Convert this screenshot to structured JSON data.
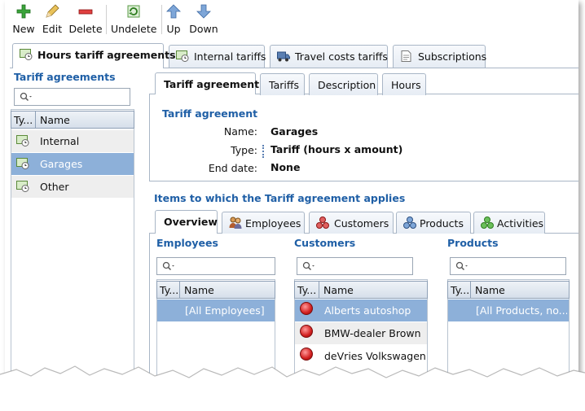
{
  "toolbar": {
    "buttons": [
      {
        "label": "New"
      },
      {
        "label": "Edit"
      },
      {
        "label": "Delete"
      },
      {
        "label": "Undelete"
      },
      {
        "label": "Up"
      },
      {
        "label": "Down"
      }
    ]
  },
  "main_tabs": [
    {
      "label": "Hours tariff agreements"
    },
    {
      "label": "Internal tariffs"
    },
    {
      "label": "Travel costs tariffs"
    },
    {
      "label": "Subscriptions"
    }
  ],
  "left_panel": {
    "title": "Tariff agreements",
    "columns": [
      "Ty...",
      "Name"
    ],
    "rows": [
      {
        "name": "Internal"
      },
      {
        "name": "Garages"
      },
      {
        "name": "Other"
      }
    ],
    "selected_index": 1
  },
  "detail_tabs": [
    {
      "label": "Tariff agreement"
    },
    {
      "label": "Tariffs"
    },
    {
      "label": "Description"
    },
    {
      "label": "Hours"
    }
  ],
  "tariff_agreement": {
    "section_title": "Tariff agreement",
    "fields": [
      {
        "label": "Name:",
        "value": "Garages"
      },
      {
        "label": "Type:",
        "value": "Tariff (hours x amount)"
      },
      {
        "label": "End date:",
        "value": "None"
      }
    ]
  },
  "applies": {
    "title": "Items to which the Tariff agreement applies",
    "tabs": [
      {
        "label": "Overview"
      },
      {
        "label": "Employees"
      },
      {
        "label": "Customers"
      },
      {
        "label": "Products"
      },
      {
        "label": "Activities"
      }
    ],
    "employees": {
      "title": "Employees",
      "columns": [
        "Ty...",
        "Name"
      ],
      "rows": [
        "[All Employees]"
      ]
    },
    "customers": {
      "title": "Customers",
      "columns": [
        "Ty...",
        "Name"
      ],
      "rows": [
        "Alberts autoshop",
        "BMW-dealer Brown",
        "deVries Volkswagen"
      ]
    },
    "products": {
      "title": "Products",
      "columns": [
        "Ty...",
        "Name"
      ],
      "rows": [
        "[All Products, no..."
      ]
    }
  },
  "colors": {
    "accent": "#1f5fa6",
    "selection": "#8db0d9"
  }
}
